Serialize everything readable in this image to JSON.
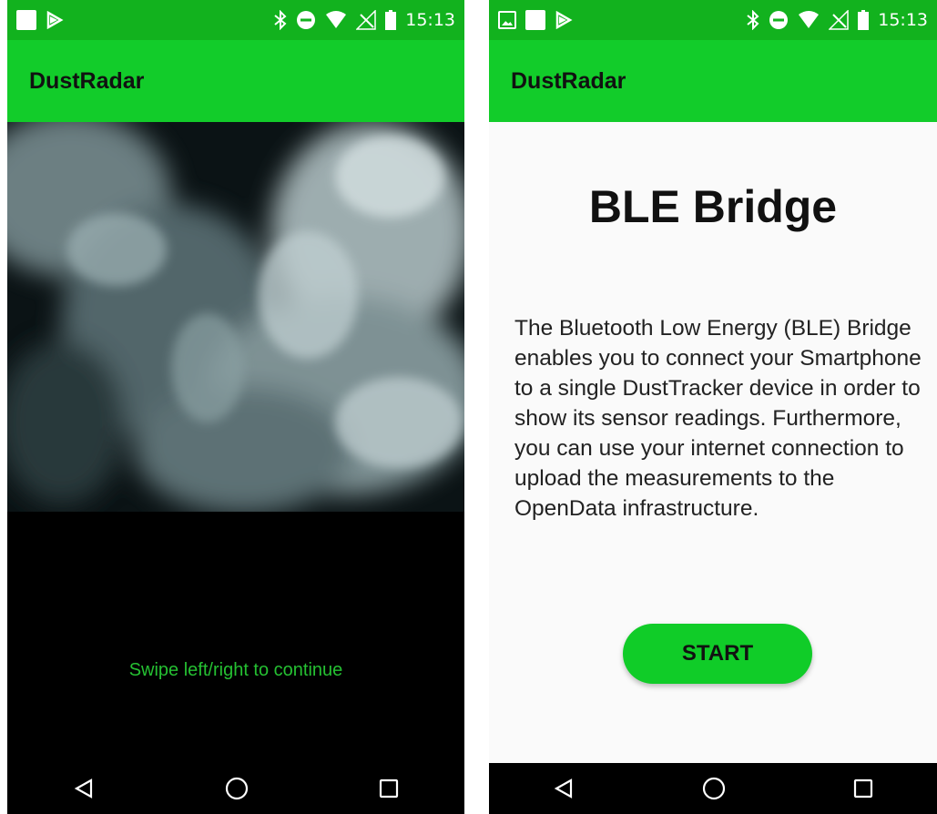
{
  "left_screen": {
    "status": {
      "time": "15:13"
    },
    "app_bar": {
      "title": "DustRadar"
    },
    "hint": "Swipe left/right to continue",
    "background_image": "smoke-image"
  },
  "right_screen": {
    "status": {
      "time": "15:13"
    },
    "app_bar": {
      "title": "DustRadar"
    },
    "title": "BLE Bridge",
    "description": "The Bluetooth Low Energy (BLE) Bridge enables you to connect your Smartphone to a single DustTracker device in order to show its sensor readings. Furthermore, you can use your internet connection to upload the measurements to the OpenData infrastructure.",
    "start_button": "START"
  },
  "colors": {
    "status_bar": "#12b21e",
    "app_bar": "#12cc2a",
    "accent_button": "#10cc28",
    "hint_text": "#25c032"
  },
  "icons": [
    "image-icon",
    "square-icon",
    "play-store-icon",
    "bluetooth-icon",
    "dnd-icon",
    "wifi-icon",
    "no-signal-icon",
    "battery-icon",
    "back-icon",
    "home-icon",
    "recents-icon"
  ]
}
